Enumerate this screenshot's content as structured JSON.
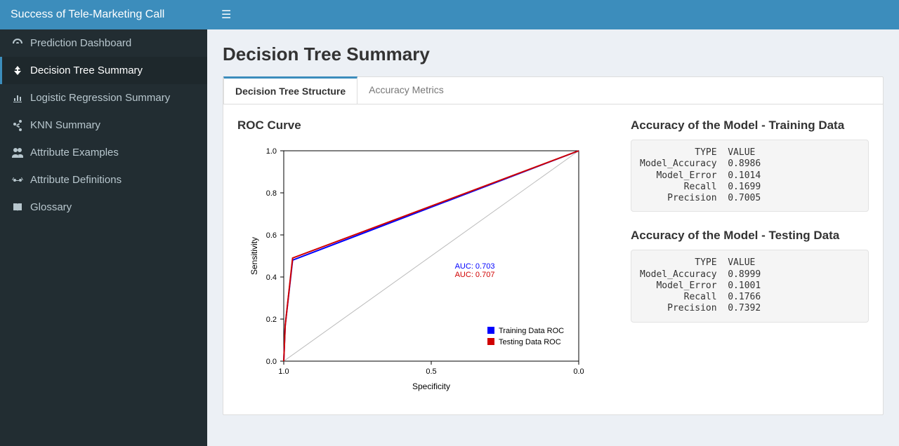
{
  "app_title": "Success of Tele-Marketing Call",
  "sidebar": {
    "items": [
      {
        "icon": "dashboard-icon",
        "label": "Prediction Dashboard"
      },
      {
        "icon": "tree-icon",
        "label": "Decision Tree Summary"
      },
      {
        "icon": "chart-icon",
        "label": "Logistic Regression Summary"
      },
      {
        "icon": "share-icon",
        "label": "KNN Summary"
      },
      {
        "icon": "users-icon",
        "label": "Attribute Examples"
      },
      {
        "icon": "glasses-icon",
        "label": "Attribute Definitions"
      },
      {
        "icon": "book-icon",
        "label": "Glossary"
      }
    ],
    "active_index": 1
  },
  "page": {
    "title": "Decision Tree Summary",
    "tabs": [
      {
        "label": "Decision Tree Structure"
      },
      {
        "label": "Accuracy Metrics"
      }
    ],
    "active_tab": 0
  },
  "roc_panel_title": "ROC Curve",
  "metrics": {
    "training_title": "Accuracy of the Model - Training Data",
    "testing_title": "Accuracy of the Model - Testing Data",
    "header_type": "TYPE",
    "header_value": "VALUE",
    "training": [
      {
        "type": "Model_Accuracy",
        "value": "0.8986"
      },
      {
        "type": "Model_Error",
        "value": "0.1014"
      },
      {
        "type": "Recall",
        "value": "0.1699"
      },
      {
        "type": "Precision",
        "value": "0.7005"
      }
    ],
    "testing": [
      {
        "type": "Model_Accuracy",
        "value": "0.8999"
      },
      {
        "type": "Model_Error",
        "value": "0.1001"
      },
      {
        "type": "Recall",
        "value": "0.1766"
      },
      {
        "type": "Precision",
        "value": "0.7392"
      }
    ]
  },
  "chart_data": {
    "type": "line",
    "title": "",
    "xlabel": "Specificity",
    "ylabel": "Sensitivity",
    "x_ticks": [
      1.0,
      0.5,
      0.0
    ],
    "y_ticks": [
      0.0,
      0.2,
      0.4,
      0.6,
      0.8,
      1.0
    ],
    "xlim": [
      1.0,
      0.0
    ],
    "ylim": [
      0.0,
      1.0
    ],
    "diagonal": true,
    "series": [
      {
        "name": "Training Data ROC",
        "color": "#0000ff",
        "auc_label": "AUC: 0.703",
        "points": [
          {
            "spec": 1.0,
            "sens": 0.0
          },
          {
            "spec": 0.995,
            "sens": 0.17
          },
          {
            "spec": 0.97,
            "sens": 0.48
          },
          {
            "spec": 0.0,
            "sens": 1.0
          }
        ]
      },
      {
        "name": "Testing Data ROC",
        "color": "#d00000",
        "auc_label": "AUC: 0.707",
        "points": [
          {
            "spec": 1.0,
            "sens": 0.0
          },
          {
            "spec": 0.995,
            "sens": 0.17
          },
          {
            "spec": 0.97,
            "sens": 0.49
          },
          {
            "spec": 0.0,
            "sens": 1.0
          }
        ]
      }
    ],
    "legend": [
      "Training Data ROC",
      "Testing Data ROC"
    ]
  }
}
